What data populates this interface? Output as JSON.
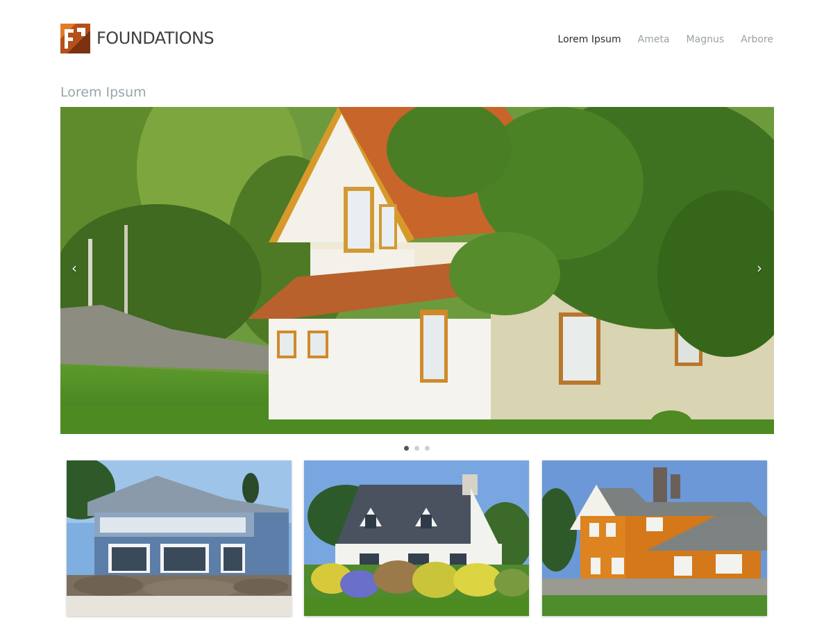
{
  "brand": {
    "name": "FOUNDATIONS",
    "logo_icon": "foundations-logo-icon",
    "logo_color": "#c1571a"
  },
  "nav": {
    "items": [
      {
        "label": "Lorem Ipsum",
        "active": true
      },
      {
        "label": "Ameta",
        "active": false
      },
      {
        "label": "Magnus",
        "active": false
      },
      {
        "label": "Arbore",
        "active": false
      }
    ]
  },
  "page": {
    "title": "Lorem Ipsum"
  },
  "slider": {
    "prev_icon": "chevron-left-icon",
    "next_icon": "chevron-right-icon",
    "prev_glyph": "‹",
    "next_glyph": "›",
    "slide_count": 3,
    "active_slide": 1
  },
  "thumbnails": [
    {
      "name": "blue-beach-house-thumbnail"
    },
    {
      "name": "white-cottage-thumbnail"
    },
    {
      "name": "orange-house-thumbnail"
    }
  ],
  "colors": {
    "accent": "#c1571a",
    "nav_active": "#2b2b2b",
    "nav_inactive": "#9aa1a6",
    "title": "#9ba4a9"
  }
}
